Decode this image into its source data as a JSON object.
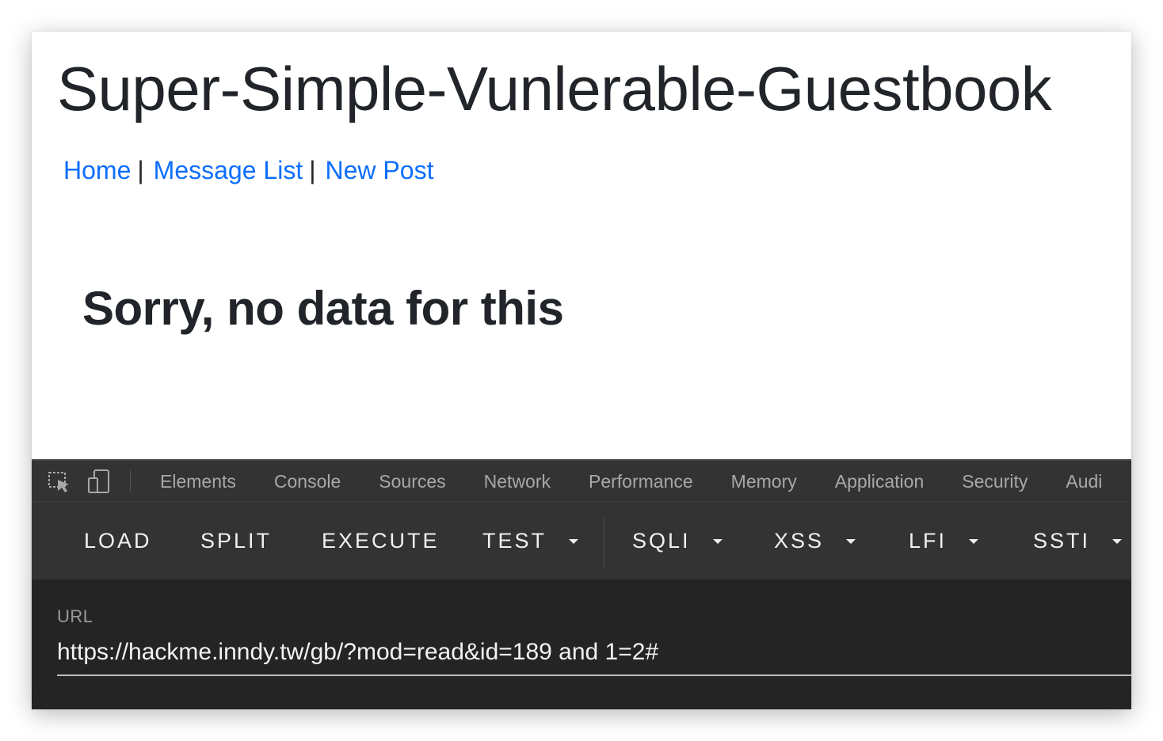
{
  "page": {
    "site_title": "Super-Simple-Vunlerable-Guestbook",
    "nav": {
      "items": [
        {
          "label": "Home"
        },
        {
          "label": "Message List"
        },
        {
          "label": "New Post"
        }
      ],
      "separator": "|"
    },
    "message": "Sorry, no data for this"
  },
  "devtools": {
    "icons": [
      "inspect-element-icon",
      "device-toggle-icon"
    ],
    "tabs": [
      {
        "label": "Elements"
      },
      {
        "label": "Console"
      },
      {
        "label": "Sources"
      },
      {
        "label": "Network"
      },
      {
        "label": "Performance"
      },
      {
        "label": "Memory"
      },
      {
        "label": "Application"
      },
      {
        "label": "Security"
      },
      {
        "label": "Audi"
      }
    ]
  },
  "hackbar": {
    "buttons": [
      {
        "label": "LOAD"
      },
      {
        "label": "SPLIT"
      },
      {
        "label": "EXECUTE"
      },
      {
        "label": "TEST"
      },
      {
        "label": "SQLI"
      },
      {
        "label": "XSS"
      },
      {
        "label": "LFI"
      },
      {
        "label": "SSTI"
      }
    ],
    "url_label": "URL",
    "url_value": "https://hackme.inndy.tw/gb/?mod=read&id=189 and 1=2#"
  },
  "colors": {
    "link": "#0d6efd",
    "text": "#212529",
    "devtools_bg": "#333333",
    "devtools_body": "#242424"
  }
}
